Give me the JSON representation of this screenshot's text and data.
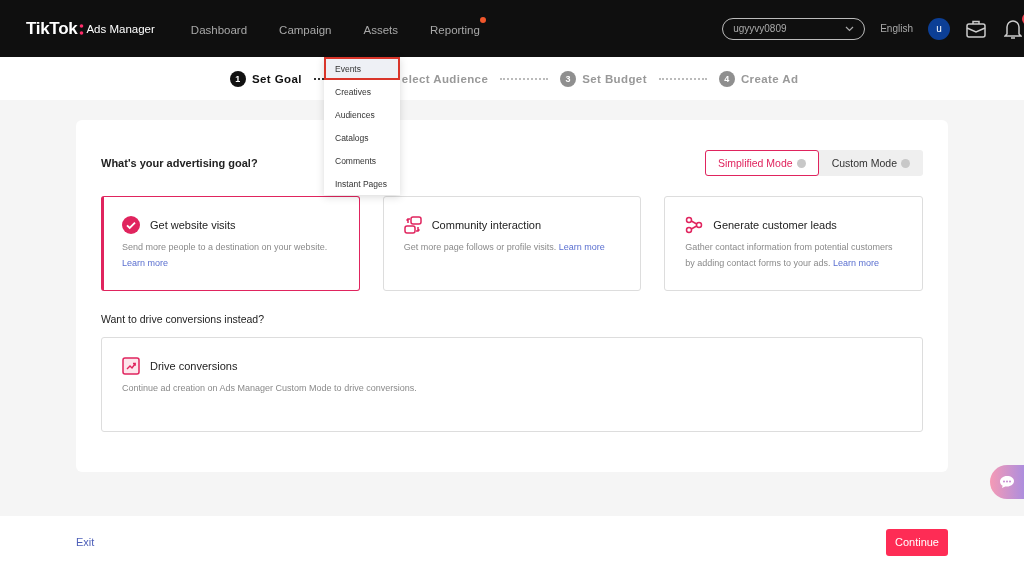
{
  "header": {
    "logo": {
      "brand": "TikTok",
      "product": "Ads Manager"
    },
    "nav": [
      {
        "label": "Dashboard",
        "dot": false
      },
      {
        "label": "Campaign",
        "dot": false
      },
      {
        "label": "Assets",
        "dot": false
      },
      {
        "label": "Reporting",
        "dot": true
      }
    ],
    "account": "ugyyvy0809",
    "language": "English",
    "avatar": "u"
  },
  "assets_menu": [
    {
      "label": "Events",
      "selected": true
    },
    {
      "label": "Creatives",
      "selected": false
    },
    {
      "label": "Audiences",
      "selected": false
    },
    {
      "label": "Catalogs",
      "selected": false
    },
    {
      "label": "Comments",
      "selected": false
    },
    {
      "label": "Instant Pages",
      "selected": false
    }
  ],
  "steps": [
    {
      "number": "1",
      "label": "Set Goal",
      "selected": true
    },
    {
      "label": "elect Audience",
      "selected": false
    },
    {
      "number": "3",
      "label": "Set Budget",
      "selected": false
    },
    {
      "number": "4",
      "label": "Create Ad",
      "selected": false
    }
  ],
  "goal_question": "What's your advertising goal?",
  "modes": [
    {
      "label": "Simplified Mode",
      "selected": true
    },
    {
      "label": "Custom Mode",
      "selected": false
    }
  ],
  "goals": [
    {
      "title": "Get website visits",
      "description": "Send more people to a destination on your website.",
      "link": "Learn more",
      "selected": true
    },
    {
      "title": "Community interaction",
      "description": "Get more page follows or profile visits.",
      "link": "Learn more",
      "selected": false
    },
    {
      "title": "Generate customer leads",
      "description": "Gather contact information from potential customers by adding contact forms to your ads.",
      "link": "Learn more",
      "selected": false
    }
  ],
  "conversion_question": "Want to drive conversions instead?",
  "conversion": {
    "title": "Drive conversions",
    "description": "Continue ad creation on Ads Manager Custom Mode to drive conversions."
  },
  "footer": {
    "exit": "Exit",
    "continue": "Continue"
  }
}
